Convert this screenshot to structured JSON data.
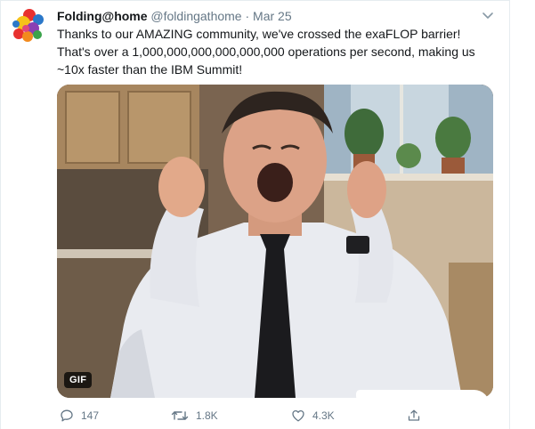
{
  "tweet": {
    "display_name": "Folding@home",
    "handle": "@foldingathome",
    "separator": "·",
    "date": "Mar 25",
    "text_lines": [
      "Thanks to our AMAZING community, we've crossed the exaFLOP barrier!",
      "That's over a 1,000,000,000,000,000,000 operations per second, making us",
      "~10x faster than the IBM Summit!"
    ],
    "avatar_icon": "folding-at-home-logo-icon",
    "menu_icon": "chevron-down-icon"
  },
  "media": {
    "type": "gif",
    "badge": "GIF",
    "content": "man in white shirt and black tie screaming with excitement"
  },
  "actions": {
    "reply": {
      "icon": "reply-icon",
      "count": "147"
    },
    "retweet": {
      "icon": "retweet-icon",
      "count": "1.8K"
    },
    "like": {
      "icon": "heart-icon",
      "count": "4.3K"
    },
    "share": {
      "icon": "share-icon"
    }
  },
  "colors": {
    "text_primary": "#14171a",
    "text_secondary": "#657786",
    "divider": "#e6ecf0"
  }
}
